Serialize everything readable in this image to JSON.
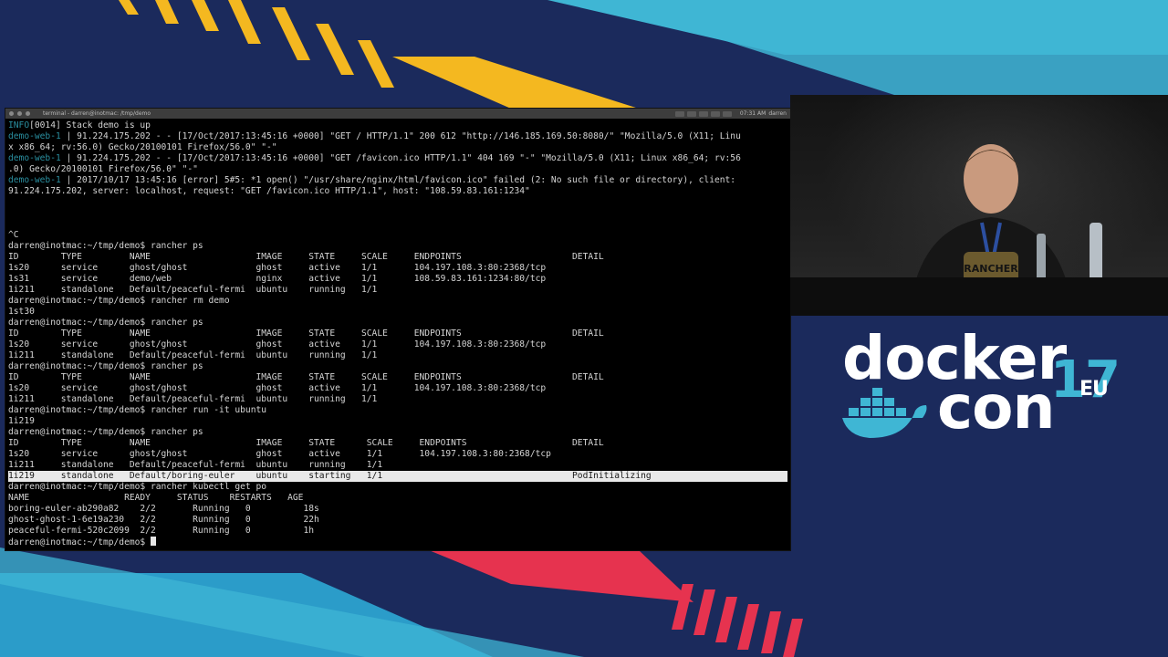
{
  "colors": {
    "background": "#1b2a5c",
    "accent_cyan": "#3fb6d4",
    "accent_yellow": "#f4b820",
    "accent_pink": "#e6334f",
    "terminal_bg": "#000000",
    "terminal_fg": "#d4d4d4",
    "log_prefix": "#2a8fa0"
  },
  "terminal": {
    "title": "terminal - darren@inotmac: /tmp/demo",
    "tray_clock": "07:31 AM",
    "tray_user": "darren",
    "lines": [
      {
        "prefix": "INFO",
        "text": "[0014] Stack demo is up"
      },
      {
        "prefix": "demo-web-1",
        "text": " | 91.224.175.202 - - [17/Oct/2017:13:45:16 +0000] \"GET / HTTP/1.1\" 200 612 \"http://146.185.169.50:8080/\" \"Mozilla/5.0 (X11; Linu"
      },
      {
        "prefix": "",
        "text": "x x86_64; rv:56.0) Gecko/20100101 Firefox/56.0\" \"-\""
      },
      {
        "prefix": "demo-web-1",
        "text": " | 91.224.175.202 - - [17/Oct/2017:13:45:16 +0000] \"GET /favicon.ico HTTP/1.1\" 404 169 \"-\" \"Mozilla/5.0 (X11; Linux x86_64; rv:56"
      },
      {
        "prefix": "",
        "text": ".0) Gecko/20100101 Firefox/56.0\" \"-\""
      },
      {
        "prefix": "demo-web-1",
        "text": " | 2017/10/17 13:45:16 [error] 5#5: *1 open() \"/usr/share/nginx/html/favicon.ico\" failed (2: No such file or directory), client:"
      },
      {
        "prefix": "",
        "text": "91.224.175.202, server: localhost, request: \"GET /favicon.ico HTTP/1.1\", host: \"108.59.83.161:1234\""
      },
      {
        "prefix": "",
        "text": ""
      },
      {
        "prefix": "",
        "text": ""
      },
      {
        "prefix": "",
        "text": ""
      },
      {
        "prefix": "",
        "text": "^C"
      },
      {
        "prefix": "",
        "text": "darren@inotmac:~/tmp/demo$ rancher ps"
      },
      {
        "prefix": "",
        "text": "ID        TYPE         NAME                    IMAGE     STATE     SCALE     ENDPOINTS                     DETAIL"
      },
      {
        "prefix": "",
        "text": "1s20      service      ghost/ghost             ghost     active    1/1       104.197.108.3:80:2368/tcp"
      },
      {
        "prefix": "",
        "text": "1s31      service      demo/web                nginx     active    1/1       108.59.83.161:1234:80/tcp"
      },
      {
        "prefix": "",
        "text": "1i211     standalone   Default/peaceful-fermi  ubuntu    running   1/1"
      },
      {
        "prefix": "",
        "text": "darren@inotmac:~/tmp/demo$ rancher rm demo"
      },
      {
        "prefix": "",
        "text": "1st30"
      },
      {
        "prefix": "",
        "text": "darren@inotmac:~/tmp/demo$ rancher ps"
      },
      {
        "prefix": "",
        "text": "ID        TYPE         NAME                    IMAGE     STATE     SCALE     ENDPOINTS                     DETAIL"
      },
      {
        "prefix": "",
        "text": "1s20      service      ghost/ghost             ghost     active    1/1       104.197.108.3:80:2368/tcp"
      },
      {
        "prefix": "",
        "text": "1i211     standalone   Default/peaceful-fermi  ubuntu    running   1/1"
      },
      {
        "prefix": "",
        "text": "darren@inotmac:~/tmp/demo$ rancher ps"
      },
      {
        "prefix": "",
        "text": "ID        TYPE         NAME                    IMAGE     STATE     SCALE     ENDPOINTS                     DETAIL"
      },
      {
        "prefix": "",
        "text": "1s20      service      ghost/ghost             ghost     active    1/1       104.197.108.3:80:2368/tcp"
      },
      {
        "prefix": "",
        "text": "1i211     standalone   Default/peaceful-fermi  ubuntu    running   1/1"
      },
      {
        "prefix": "",
        "text": "darren@inotmac:~/tmp/demo$ rancher run -it ubuntu"
      },
      {
        "prefix": "",
        "text": "1i219"
      },
      {
        "prefix": "",
        "text": "darren@inotmac:~/tmp/demo$ rancher ps"
      },
      {
        "prefix": "",
        "text": "ID        TYPE         NAME                    IMAGE     STATE      SCALE     ENDPOINTS                    DETAIL"
      },
      {
        "prefix": "",
        "text": "1s20      service      ghost/ghost             ghost     active     1/1       104.197.108.3:80:2368/tcp"
      },
      {
        "prefix": "",
        "text": "1i211     standalone   Default/peaceful-fermi  ubuntu    running    1/1"
      },
      {
        "prefix": "",
        "text": "1i219     standalone   Default/boring-euler    ubuntu    starting   1/1                                    PodInitializing",
        "highlight": true
      },
      {
        "prefix": "",
        "text": "darren@inotmac:~/tmp/demo$ rancher kubectl get po"
      },
      {
        "prefix": "",
        "text": "NAME                  READY     STATUS    RESTARTS   AGE"
      },
      {
        "prefix": "",
        "text": "boring-euler-ab290a82    2/2       Running   0          18s"
      },
      {
        "prefix": "",
        "text": "ghost-ghost-1-6e19a230   2/2       Running   0          22h"
      },
      {
        "prefix": "",
        "text": "peaceful-fermi-520c2099  2/2       Running   0          1h"
      },
      {
        "prefix": "",
        "text": "darren@inotmac:~/tmp/demo$ ",
        "cursor": true
      }
    ]
  },
  "speaker_video": {
    "shirt_text": "RANCHER"
  },
  "logo": {
    "word1": "docker",
    "word2": "con",
    "year": "17",
    "region": "EU",
    "icon": "docker-whale-icon"
  }
}
